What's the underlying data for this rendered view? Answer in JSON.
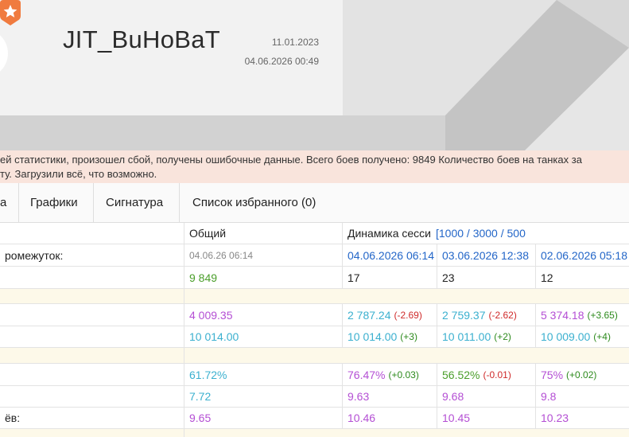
{
  "header": {
    "player_name": "JIT_BuHoBaT",
    "registration_date": "11.01.2023",
    "updated_at": "04.06.2026 00:49",
    "badge_color": "#f07b3f"
  },
  "warning": {
    "line1": "ей статистики, произошел сбой, получены ошибочные данные. Всего боев получено: 9849 Количество боев на танках за",
    "line2": "ту. Загрузили всё, что возможно."
  },
  "tabs": [
    {
      "label": "а"
    },
    {
      "label": "Графики"
    },
    {
      "label": "Сигнатура"
    },
    {
      "label": "Список избранного (0)"
    }
  ],
  "table": {
    "header": {
      "total": "Общий",
      "dynamics": "Динамика сесси",
      "session_sizes": "[1000 / 3000 / 500"
    },
    "period_row": {
      "label": "ромежуток:",
      "total": "04.06.26 06:14",
      "s1": "04.06.2026 06:14",
      "s2": "03.06.2026 12:38",
      "s3": "02.06.2026 05:18"
    },
    "battles": {
      "total": "9 849",
      "s1": "17",
      "s2": "23",
      "s3": "12"
    },
    "rating1": {
      "total": "4 009.35",
      "s1": "2 787.24",
      "s1d": "(-2.69)",
      "s2": "2 759.37",
      "s2d": "(-2.62)",
      "s3": "5 374.18",
      "s3d": "(+3.65)"
    },
    "rating2": {
      "total": "10 014.00",
      "s1": "10 014.00",
      "s1d": "(+3)",
      "s2": "10 011.00",
      "s2d": "(+2)",
      "s3": "10 009.00",
      "s3d": "(+4)"
    },
    "winrate": {
      "total": "61.72%",
      "s1": "76.47%",
      "s1d": "(+0.03)",
      "s2": "56.52%",
      "s2d": "(-0.01)",
      "s3": "75%",
      "s3d": "(+0.02)"
    },
    "metric1": {
      "total": "7.72",
      "s1": "9.63",
      "s2": "9.68",
      "s3": "9.8"
    },
    "metric2": {
      "label": "ёв:",
      "total": "9.65",
      "s1": "10.46",
      "s2": "10.45",
      "s3": "10.23"
    }
  }
}
